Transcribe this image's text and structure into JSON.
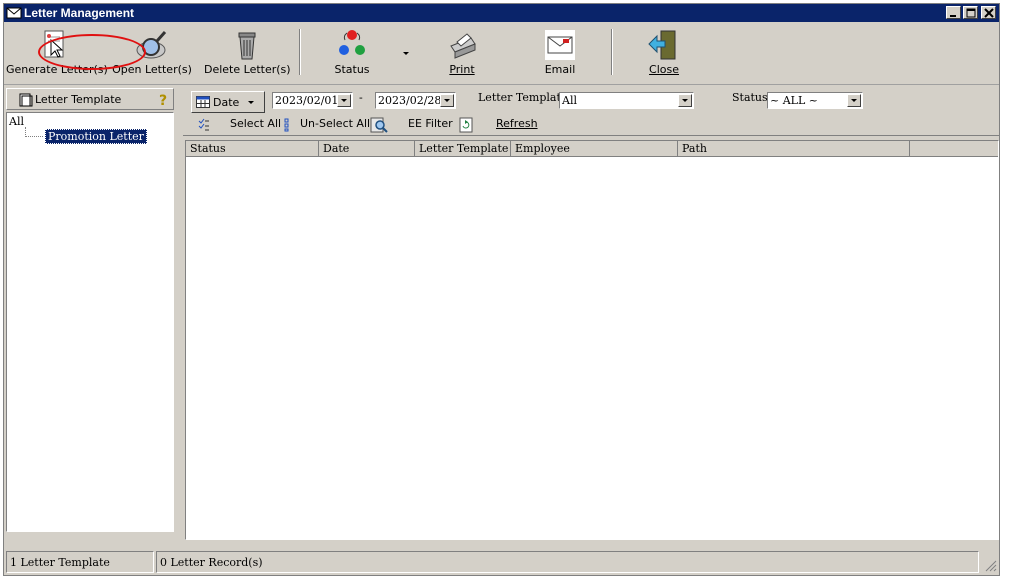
{
  "window": {
    "title": "Letter Management"
  },
  "toolbar": {
    "generate_label": "Generate Letter(s)",
    "open_label": "Open Letter(s)",
    "delete_label": "Delete Letter(s)",
    "status_label": "Status",
    "print_label": "Print",
    "email_label": "Email",
    "close_label": "Close"
  },
  "left_pane": {
    "header": "Letter Template",
    "tree": {
      "root": "All",
      "children": [
        "Promotion Letter"
      ]
    }
  },
  "filters": {
    "date_button": "Date",
    "date_from": "2023/02/01",
    "separator": "-",
    "date_to": "2023/02/28",
    "template_label": "Letter Template",
    "template_value": "All",
    "status_label": "Status",
    "status_value": "~ ALL ~"
  },
  "actions": {
    "select_all": "Select All",
    "unselect_all": "Un-Select All",
    "ee_filter": "EE Filter",
    "refresh": "Refresh"
  },
  "grid": {
    "columns": [
      "Status",
      "Date",
      "Letter Template",
      "Employee",
      "Path"
    ],
    "rows": []
  },
  "status_bar": {
    "template_count": "1 Letter Template",
    "record_count": "0 Letter Record(s)"
  },
  "colors": {
    "titlebar": "#0a246a",
    "chrome": "#d4d0c8",
    "highlight_ellipse": "#e01010"
  }
}
